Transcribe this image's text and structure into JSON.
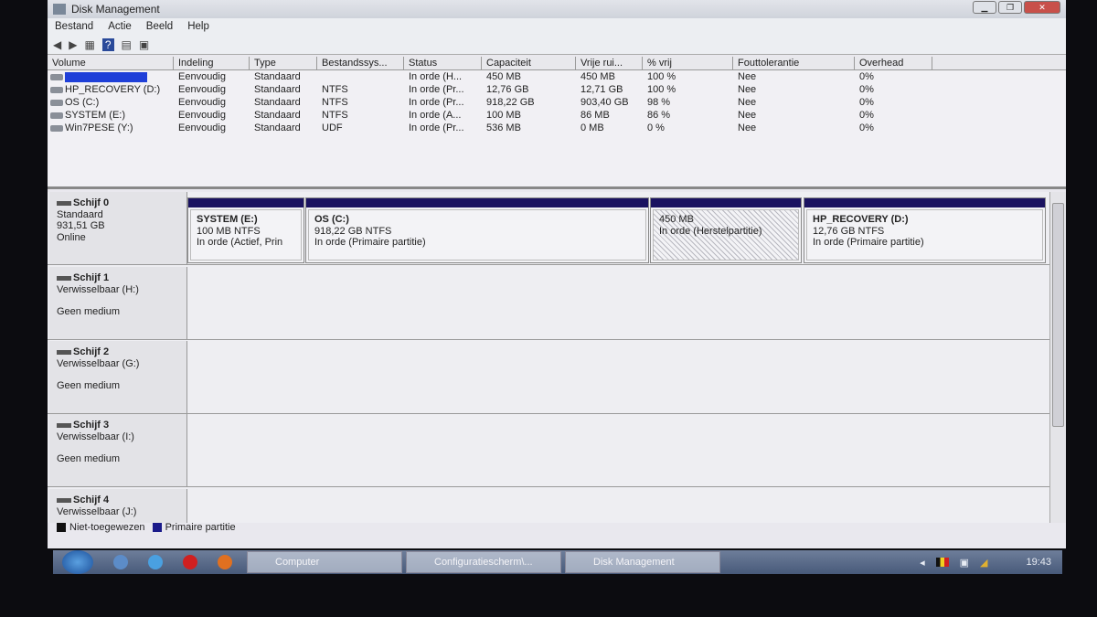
{
  "window": {
    "title": "Disk Management",
    "controls": [
      "minimize",
      "maximize",
      "close"
    ]
  },
  "menu": [
    "Bestand",
    "Actie",
    "Beeld",
    "Help"
  ],
  "toolbar": {
    "icons": [
      "back-icon",
      "forward-icon",
      "view-icon",
      "help-icon",
      "properties-icon",
      "console-icon"
    ]
  },
  "volumes": {
    "columns": [
      "Volume",
      "Indeling",
      "Type",
      "Bestandssys...",
      "Status",
      "Capaciteit",
      "Vrije rui...",
      "% vrij",
      "Fouttolerantie",
      "Overhead"
    ],
    "rows": [
      [
        "",
        "Eenvoudig",
        "Standaard",
        "",
        "In orde (H...",
        "450 MB",
        "450 MB",
        "100 %",
        "Nee",
        "0%"
      ],
      [
        "HP_RECOVERY (D:)",
        "Eenvoudig",
        "Standaard",
        "NTFS",
        "In orde (Pr...",
        "12,76 GB",
        "12,71 GB",
        "100 %",
        "Nee",
        "0%"
      ],
      [
        "OS (C:)",
        "Eenvoudig",
        "Standaard",
        "NTFS",
        "In orde (Pr...",
        "918,22 GB",
        "903,40 GB",
        "98 %",
        "Nee",
        "0%"
      ],
      [
        "SYSTEM (E:)",
        "Eenvoudig",
        "Standaard",
        "NTFS",
        "In orde (A...",
        "100 MB",
        "86 MB",
        "86 %",
        "Nee",
        "0%"
      ],
      [
        "Win7PESE (Y:)",
        "Eenvoudig",
        "Standaard",
        "UDF",
        "In orde (Pr...",
        "536 MB",
        "0 MB",
        "0 %",
        "Nee",
        "0%"
      ]
    ]
  },
  "disks": [
    {
      "name": "Schijf 0",
      "type": "Standaard",
      "size": "931,51 GB",
      "state": "Online",
      "partitions": [
        {
          "name": "SYSTEM  (E:)",
          "size": "100 MB NTFS",
          "status": "In orde (Actief, Prin"
        },
        {
          "name": "OS  (C:)",
          "size": "918,22 GB NTFS",
          "status": "In orde (Primaire partitie)"
        },
        {
          "name": "",
          "size": "450 MB",
          "status": "In orde (Herstelpartitie)"
        },
        {
          "name": "HP_RECOVERY  (D:)",
          "size": "12,76 GB NTFS",
          "status": "In orde (Primaire partitie)"
        }
      ]
    },
    {
      "name": "Schijf 1",
      "type": "Verwisselbaar (H:)",
      "state": "Geen medium"
    },
    {
      "name": "Schijf 2",
      "type": "Verwisselbaar (G:)",
      "state": "Geen medium"
    },
    {
      "name": "Schijf 3",
      "type": "Verwisselbaar (I:)",
      "state": "Geen medium"
    },
    {
      "name": "Schijf 4",
      "type": "Verwisselbaar (J:)"
    }
  ],
  "legend": [
    {
      "label": "Niet-toegewezen",
      "color": "#111111"
    },
    {
      "label": "Primaire partitie",
      "color": "#1a1a8a"
    }
  ],
  "taskbar": {
    "tasks": [
      "Computer",
      "Configuratiescherm\\...",
      "Disk Management"
    ],
    "clock": "19:43"
  }
}
